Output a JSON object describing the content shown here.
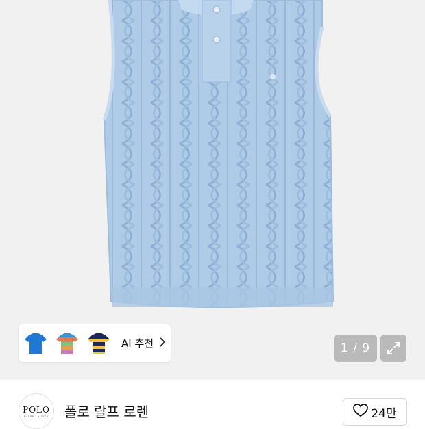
{
  "gallery": {
    "counter": "1 / 9",
    "ai_recommend_label": "AI 추천",
    "thumbnails": [
      "blue-tshirt-icon",
      "striped-tshirt-icon",
      "navy-yellow-striped-tshirt-icon"
    ]
  },
  "brand": {
    "logo_text": "POLO",
    "logo_subtext": "RALPH LAUREN",
    "name": "폴로 랄프 로렌",
    "likes": "24만"
  },
  "colors": {
    "garment": "#aecbe8",
    "background": "#f1f1f1"
  }
}
